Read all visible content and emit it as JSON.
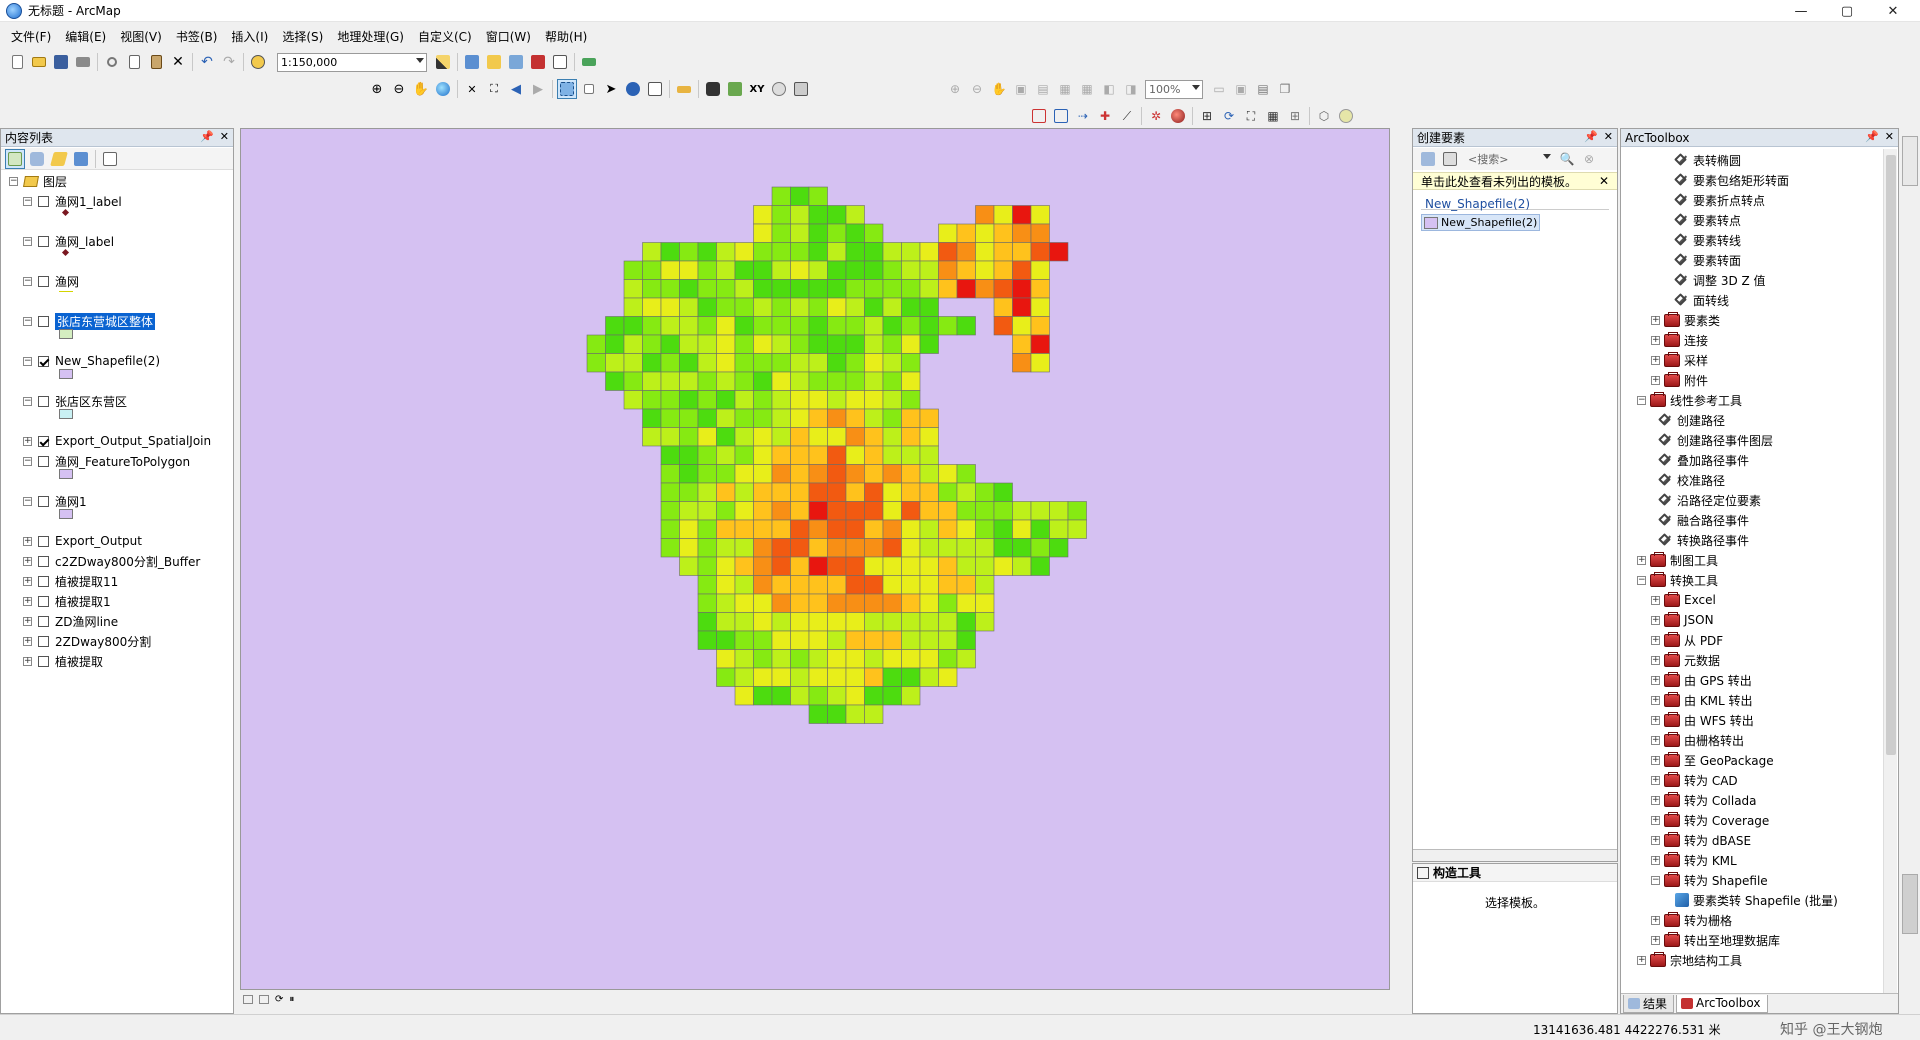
{
  "window": {
    "title": "无标题 - ArcMap",
    "minimize": "—",
    "maximize": "▢",
    "close": "✕"
  },
  "menu": [
    "文件(F)",
    "编辑(E)",
    "视图(V)",
    "书签(B)",
    "插入(I)",
    "选择(S)",
    "地理处理(G)",
    "自定义(C)",
    "窗口(W)",
    "帮助(H)"
  ],
  "toolbar": {
    "scale": "1:150,000",
    "zoom_percent": "100%"
  },
  "toc": {
    "title": "内容列表",
    "root": "图层",
    "layers": [
      {
        "name": "渔网1_label",
        "checked": false,
        "expanded": true,
        "symbol": "dot"
      },
      {
        "name": "渔网_label",
        "checked": false,
        "expanded": true,
        "symbol": "dot"
      },
      {
        "name": "渔网",
        "checked": false,
        "expanded": true,
        "symbol": "line"
      },
      {
        "name": "张店东营城区整体",
        "checked": false,
        "expanded": true,
        "symbol": "fill",
        "color": "#d4eec0",
        "selected": true
      },
      {
        "name": "New_Shapefile(2)",
        "checked": true,
        "expanded": true,
        "symbol": "fill",
        "color": "#d5c1f2"
      },
      {
        "name": "张店区东营区",
        "checked": false,
        "expanded": true,
        "symbol": "fill",
        "color": "#c9f0f3"
      },
      {
        "name": "Export_Output_SpatialJoin",
        "checked": true,
        "expanded": false
      },
      {
        "name": "渔网_FeatureToPolygon",
        "checked": false,
        "expanded": true,
        "symbol": "fill",
        "color": "#d5c1f2"
      },
      {
        "name": "渔网1",
        "checked": false,
        "expanded": true,
        "symbol": "fill",
        "color": "#d5c1f2"
      },
      {
        "name": "Export_Output",
        "checked": false,
        "expanded": false
      },
      {
        "name": "c2ZDway800分割_Buffer",
        "checked": false,
        "expanded": false
      },
      {
        "name": "植被提取11",
        "checked": false,
        "expanded": false
      },
      {
        "name": "植被提取1",
        "checked": false,
        "expanded": false
      },
      {
        "name": "ZD渔网line",
        "checked": false,
        "expanded": false
      },
      {
        "name": "2ZDway800分割",
        "checked": false,
        "expanded": false
      },
      {
        "name": "植被提取",
        "checked": false,
        "expanded": false
      }
    ]
  },
  "create_features": {
    "title": "创建要素",
    "search_placeholder": "<搜索>",
    "notice": "单击此处查看未列出的模板。",
    "group": "New_Shapefile(2)",
    "template": "New_Shapefile(2)"
  },
  "construction": {
    "title": "构造工具",
    "hint": "选择模板。"
  },
  "toolbox": {
    "title": "ArcToolbox",
    "rows": [
      {
        "label": "表转椭圆",
        "level": 3,
        "kind": "tool"
      },
      {
        "label": "要素包络矩形转面",
        "level": 3,
        "kind": "tool"
      },
      {
        "label": "要素折点转点",
        "level": 3,
        "kind": "tool"
      },
      {
        "label": "要素转点",
        "level": 3,
        "kind": "tool"
      },
      {
        "label": "要素转线",
        "level": 3,
        "kind": "tool"
      },
      {
        "label": "要素转面",
        "level": 3,
        "kind": "tool"
      },
      {
        "label": "调整 3D Z 值",
        "level": 3,
        "kind": "tool"
      },
      {
        "label": "面转线",
        "level": 3,
        "kind": "tool"
      },
      {
        "label": "要素类",
        "level": 2,
        "kind": "toolset",
        "exp": "+"
      },
      {
        "label": "连接",
        "level": 2,
        "kind": "toolset",
        "exp": "+"
      },
      {
        "label": "采样",
        "level": 2,
        "kind": "toolset",
        "exp": "+"
      },
      {
        "label": "附件",
        "level": 2,
        "kind": "toolset",
        "exp": "+"
      },
      {
        "label": "线性参考工具",
        "level": 1,
        "kind": "toolbox",
        "exp": "−"
      },
      {
        "label": "创建路径",
        "level": 2,
        "kind": "tool"
      },
      {
        "label": "创建路径事件图层",
        "level": 2,
        "kind": "tool"
      },
      {
        "label": "叠加路径事件",
        "level": 2,
        "kind": "tool"
      },
      {
        "label": "校准路径",
        "level": 2,
        "kind": "tool"
      },
      {
        "label": "沿路径定位要素",
        "level": 2,
        "kind": "tool"
      },
      {
        "label": "融合路径事件",
        "level": 2,
        "kind": "tool"
      },
      {
        "label": "转换路径事件",
        "level": 2,
        "kind": "tool"
      },
      {
        "label": "制图工具",
        "level": 1,
        "kind": "toolbox",
        "exp": "+"
      },
      {
        "label": "转换工具",
        "level": 1,
        "kind": "toolbox",
        "exp": "−"
      },
      {
        "label": "Excel",
        "level": 2,
        "kind": "toolset",
        "exp": "+"
      },
      {
        "label": "JSON",
        "level": 2,
        "kind": "toolset",
        "exp": "+"
      },
      {
        "label": "从 PDF",
        "level": 2,
        "kind": "toolset",
        "exp": "+"
      },
      {
        "label": "元数据",
        "level": 2,
        "kind": "toolset",
        "exp": "+"
      },
      {
        "label": "由 GPS 转出",
        "level": 2,
        "kind": "toolset",
        "exp": "+"
      },
      {
        "label": "由 KML 转出",
        "level": 2,
        "kind": "toolset",
        "exp": "+"
      },
      {
        "label": "由 WFS 转出",
        "level": 2,
        "kind": "toolset",
        "exp": "+"
      },
      {
        "label": "由栅格转出",
        "level": 2,
        "kind": "toolset",
        "exp": "+"
      },
      {
        "label": "至 GeoPackage",
        "level": 2,
        "kind": "toolset",
        "exp": "+"
      },
      {
        "label": "转为 CAD",
        "level": 2,
        "kind": "toolset",
        "exp": "+"
      },
      {
        "label": "转为 Collada",
        "level": 2,
        "kind": "toolset",
        "exp": "+"
      },
      {
        "label": "转为 Coverage",
        "level": 2,
        "kind": "toolset",
        "exp": "+"
      },
      {
        "label": "转为 dBASE",
        "level": 2,
        "kind": "toolset",
        "exp": "+"
      },
      {
        "label": "转为 KML",
        "level": 2,
        "kind": "toolset",
        "exp": "+"
      },
      {
        "label": "转为 Shapefile",
        "level": 2,
        "kind": "toolset",
        "exp": "−"
      },
      {
        "label": "要素类转 Shapefile (批量)",
        "level": 3,
        "kind": "script"
      },
      {
        "label": "转为栅格",
        "level": 2,
        "kind": "toolset",
        "exp": "+"
      },
      {
        "label": "转出至地理数据库",
        "level": 2,
        "kind": "toolset",
        "exp": "+"
      },
      {
        "label": "宗地结构工具",
        "level": 1,
        "kind": "toolbox",
        "exp": "+"
      }
    ],
    "tabs": [
      "结果",
      "ArcToolbox"
    ]
  },
  "status": {
    "coords": "13141636.481  4422276.531 米",
    "watermark": "知乎 @王大钢炮"
  },
  "colors": {
    "map_background": "#d5c1f2",
    "selection": "#0a63d1",
    "ramp": [
      "#e8160f",
      "#f25a11",
      "#f88f15",
      "#ffc21c",
      "#e8ee1a",
      "#bdf01a",
      "#86ea12",
      "#4ddc0f"
    ]
  }
}
